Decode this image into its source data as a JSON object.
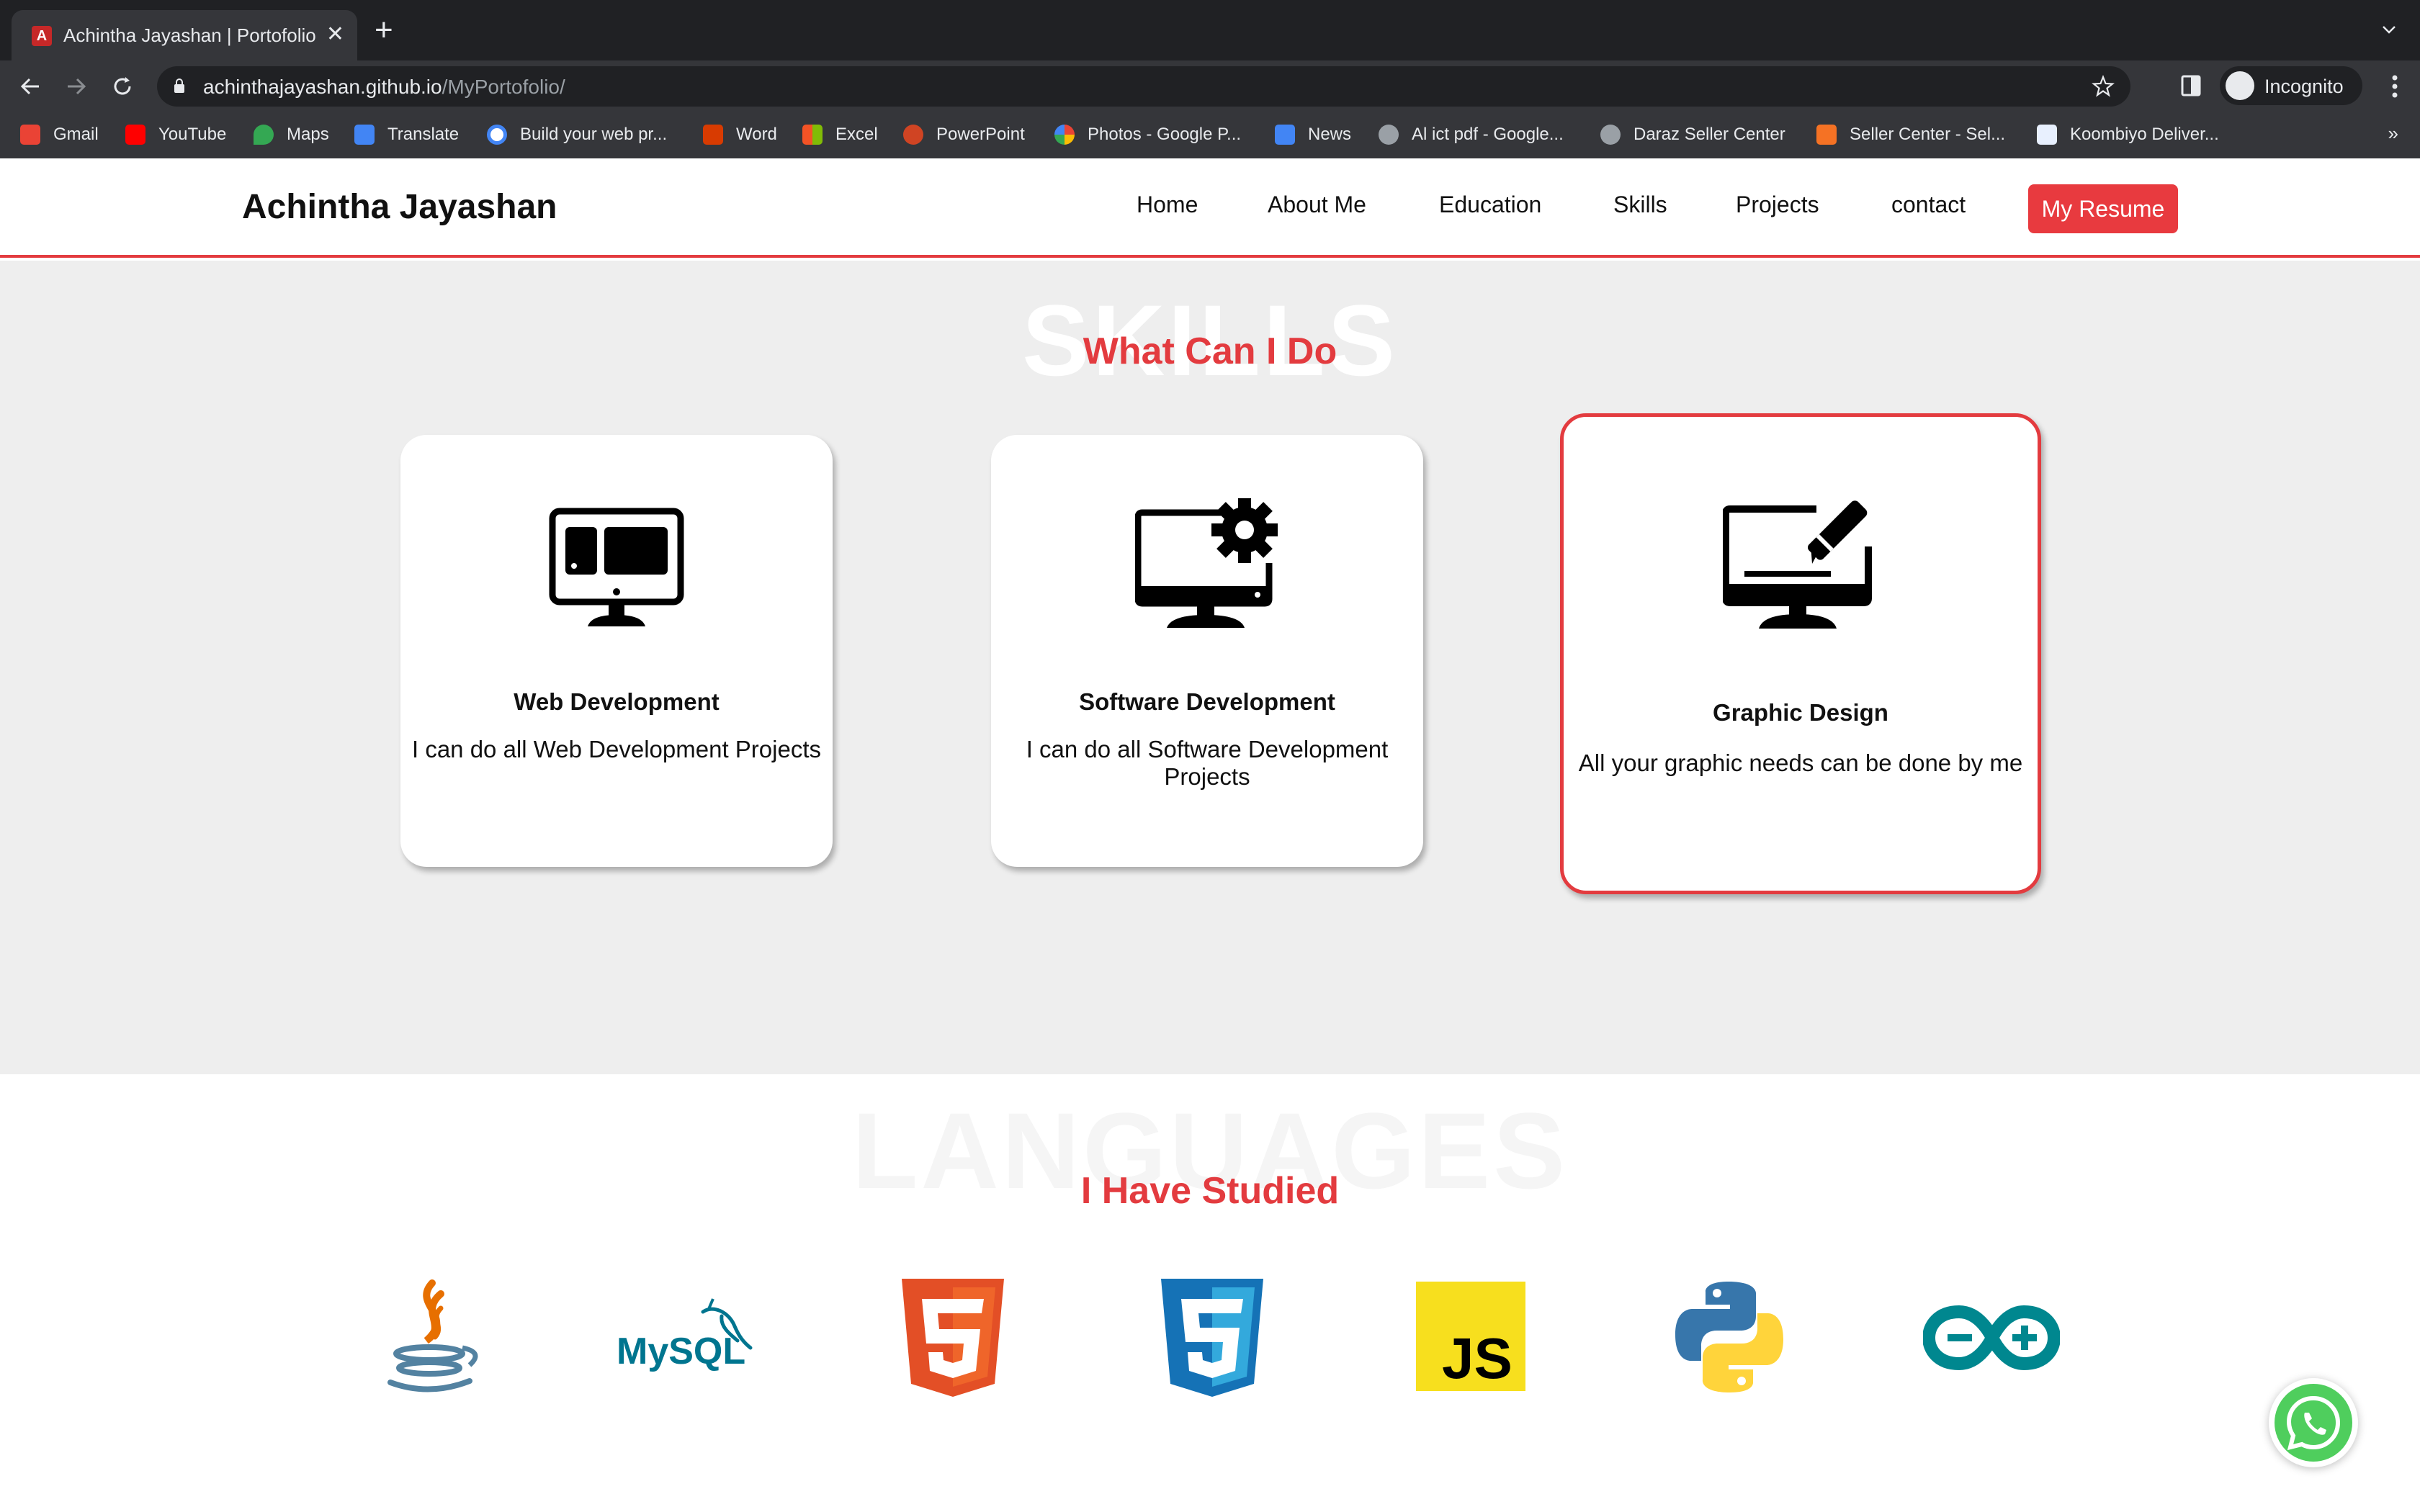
{
  "browser": {
    "tab_title": "Achintha Jayashan | Portofolio",
    "tab_favicon_letter": "A",
    "url_host": "achinthajayashan.github.io",
    "url_path": "/MyPortofolio/",
    "profile_label": "Incognito",
    "bookmarks": [
      {
        "label": "Gmail",
        "color": "#ea4335"
      },
      {
        "label": "YouTube",
        "color": "#ff0000"
      },
      {
        "label": "Maps",
        "color": "#34a853"
      },
      {
        "label": "Translate",
        "color": "#4285f4"
      },
      {
        "label": "Build your web pr...",
        "color": "#ffffff"
      },
      {
        "label": "Word",
        "color": "#d83b01"
      },
      {
        "label": "Excel",
        "color": "#4caf50"
      },
      {
        "label": "PowerPoint",
        "color": "#d04423"
      },
      {
        "label": "Photos - Google P...",
        "color": "#fbbc04"
      },
      {
        "label": "News",
        "color": "#4285f4"
      },
      {
        "label": "Al ict pdf - Google...",
        "color": "#9aa0a6"
      },
      {
        "label": "Daraz Seller Center",
        "color": "#9aa0a6"
      },
      {
        "label": "Seller Center - Sel...",
        "color": "#f57224"
      },
      {
        "label": "Koombiyo Deliver...",
        "color": "#e8f0fe"
      }
    ],
    "bookmarks_more": "»"
  },
  "site": {
    "brand": "Achintha Jayashan",
    "nav": [
      "Home",
      "About Me",
      "Education",
      "Skills",
      "Projects",
      "contact"
    ],
    "resume_button": "My Resume",
    "accent": "#e33b3f"
  },
  "skills": {
    "bg_word": "SKILLS",
    "title": "What Can I Do",
    "cards": [
      {
        "title": "Web Development",
        "desc": "I can do all Web Development Projects",
        "icon": "monitor-web-icon"
      },
      {
        "title": "Software Development",
        "desc": "I can do all Software Development Projects",
        "icon": "monitor-gear-icon"
      },
      {
        "title": "Graphic Design",
        "desc": "All your graphic needs can be done by me",
        "icon": "monitor-pen-icon",
        "active": true
      }
    ]
  },
  "languages": {
    "bg_word": "LANGUAGES",
    "title": "I Have Studied",
    "icons": [
      "java-icon",
      "mysql-icon",
      "html5-icon",
      "css3-icon",
      "javascript-icon",
      "python-icon",
      "arduino-icon"
    ],
    "mysql_text": "MySQL",
    "js_text": "JS"
  }
}
